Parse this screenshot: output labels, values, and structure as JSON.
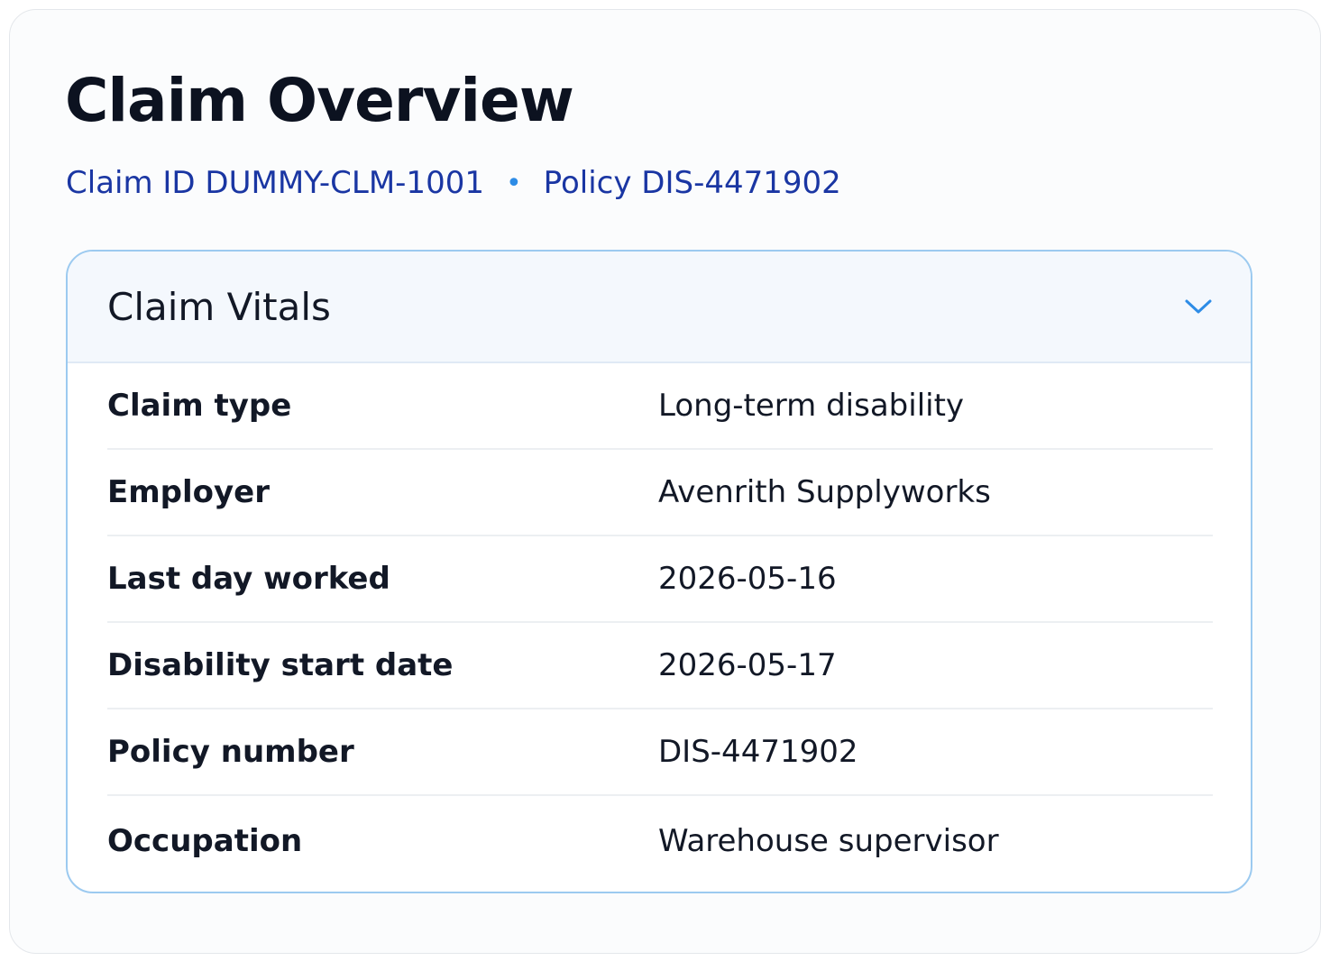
{
  "header": {
    "title": "Claim Overview",
    "claim_ref": "Claim ID DUMMY-CLM-1001",
    "separator": "•",
    "policy_ref": "Policy DIS-4471902"
  },
  "vitals": {
    "title": "Claim Vitals",
    "toggle_icon": "chevron-down-icon",
    "rows": [
      {
        "label": "Claim type",
        "value": "Long-term disability"
      },
      {
        "label": "Employer",
        "value": "Avenrith Supplyworks"
      },
      {
        "label": "Last day worked",
        "value": "2026-05-16"
      },
      {
        "label": "Disability start date",
        "value": "2026-05-17"
      },
      {
        "label": "Policy number",
        "value": "DIS-4471902"
      },
      {
        "label": "Occupation",
        "value": "Warehouse supervisor"
      }
    ]
  },
  "colors": {
    "accent": "#2d8ce6",
    "link": "#1a36a3",
    "card_border": "#9ccaf0"
  }
}
